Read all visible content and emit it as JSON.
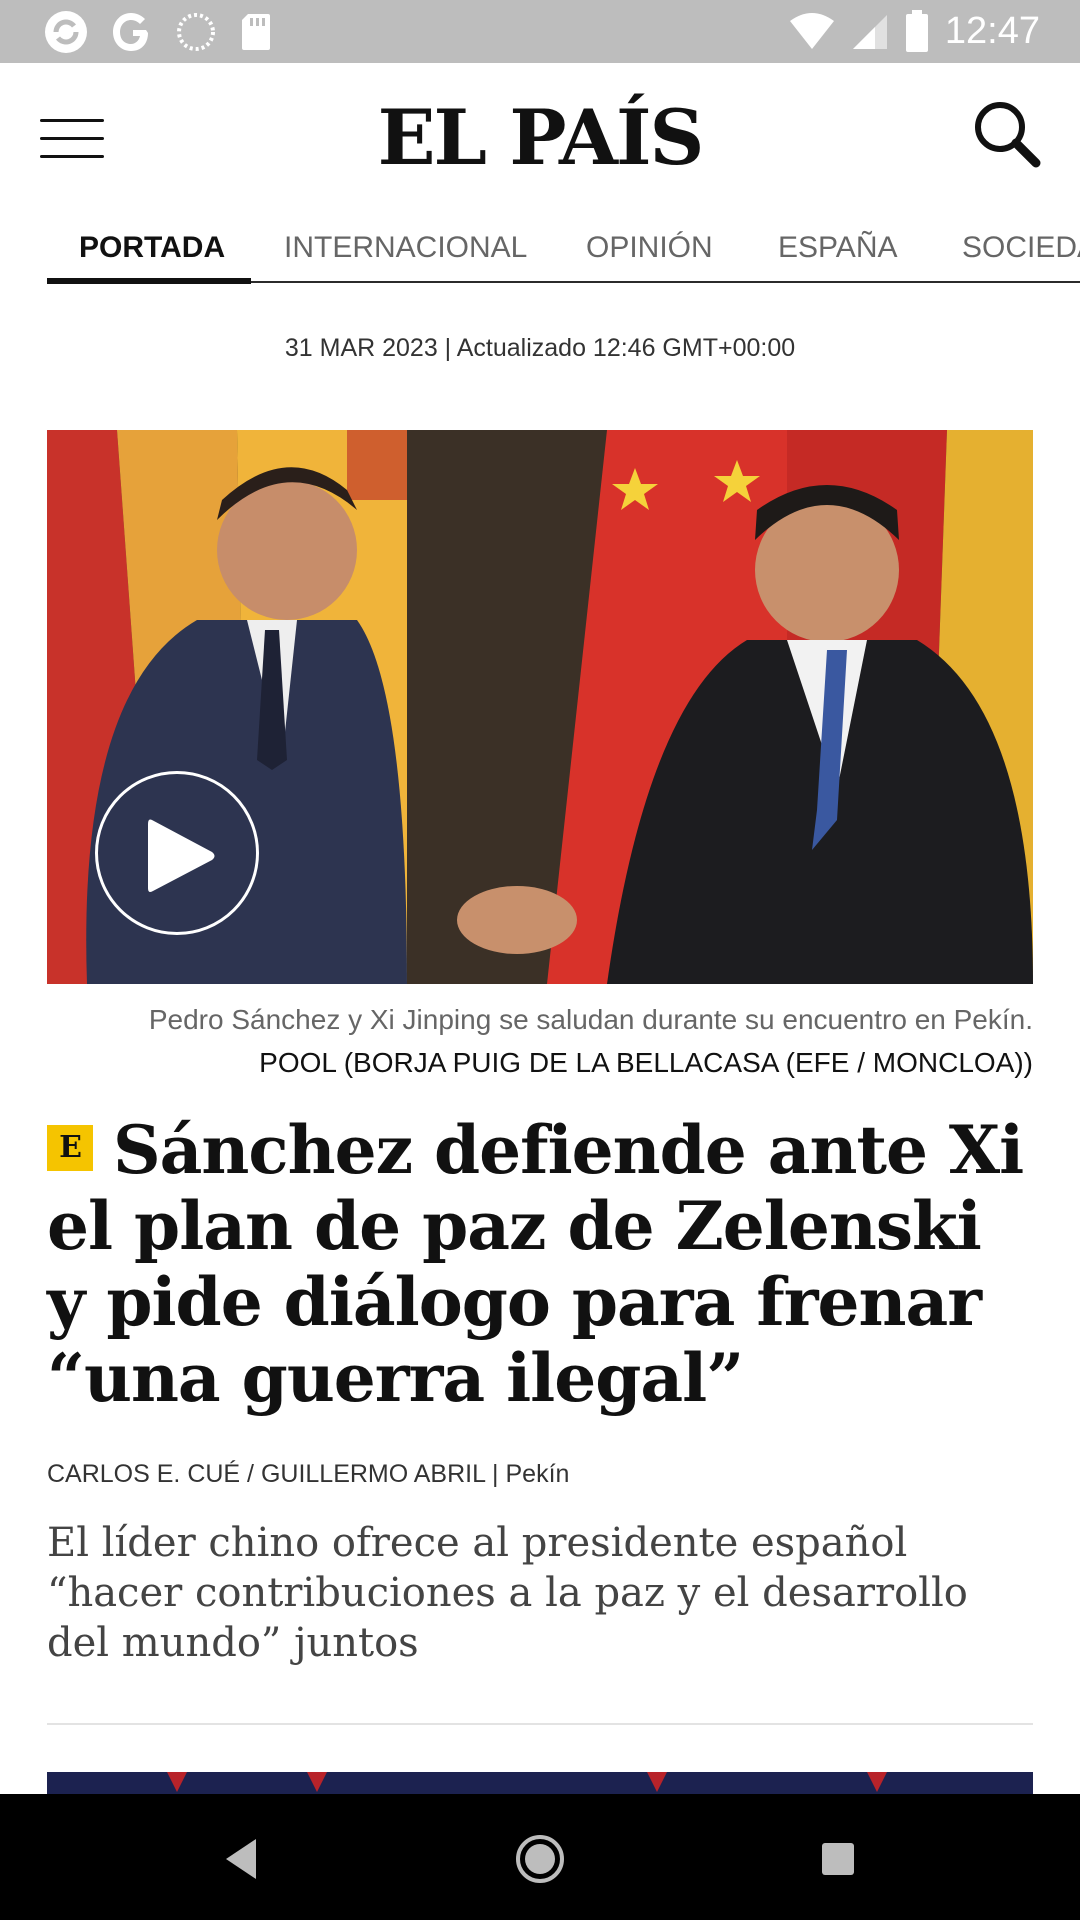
{
  "status_bar": {
    "time": "12:47",
    "icons": [
      "sync-app-icon",
      "google-icon",
      "circle-app-icon",
      "sd-card-icon",
      "wifi-icon",
      "signal-icon",
      "battery-icon"
    ]
  },
  "header": {
    "logo": "EL PAÍS",
    "menu_icon": "hamburger-menu-icon",
    "search_icon": "search-icon"
  },
  "tabs": [
    {
      "label": "PORTADA",
      "active": true
    },
    {
      "label": "INTERNACIONAL",
      "active": false
    },
    {
      "label": "OPINIÓN",
      "active": false
    },
    {
      "label": "ESPAÑA",
      "active": false
    },
    {
      "label": "SOCIEDA",
      "active": false
    }
  ],
  "article": {
    "date": "31 MAR 2023 | Actualizado 12:46 GMT+00:00",
    "caption": "Pedro Sánchez y Xi Jinping se saludan durante su encuentro en Pekín.",
    "credit": "POOL (BORJA PUIG DE LA BELLACASA (EFE / MONCLOA))",
    "badge": "E",
    "headline": "Sánchez defiende ante Xi el plan de paz de Zelenski y pide diálogo para frenar “una guerra ilegal”",
    "byline_authors": "CARLOS E. CUÉ / GUILLERMO ABRIL",
    "byline_separator": " | ",
    "byline_location": "Pekín",
    "summary": "El líder chino ofrece al presidente español “hacer contribuciones a la paz y el desarrollo del mundo” juntos"
  },
  "colors": {
    "status_bar": "#bdbdbd",
    "badge": "#f5c400",
    "logo_accent": "#2a7ec5",
    "nav_bar": "#000000"
  },
  "nav_bar": [
    "back-icon",
    "home-icon",
    "recents-icon"
  ]
}
